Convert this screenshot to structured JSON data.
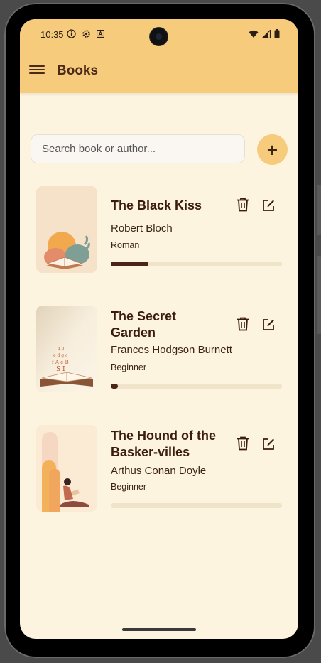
{
  "status": {
    "time": "10:35"
  },
  "appbar": {
    "title": "Books"
  },
  "search": {
    "placeholder": "Search book or author..."
  },
  "add": {
    "label": "+"
  },
  "books": [
    {
      "title": "The Black Kiss",
      "author": "Robert Bloch",
      "genre": "Roman",
      "progress": 0.22
    },
    {
      "title": "The Secret Garden",
      "author": "Frances Hodgson Burnett",
      "genre": "Beginner",
      "progress": 0.04
    },
    {
      "title": "The Hound of the Basker-villes",
      "author": "Arthus Conan Doyle",
      "genre": "Beginner",
      "progress": 0.0
    }
  ],
  "colors": {
    "appbar": "#F7CB7C",
    "background": "#FDF4DF",
    "accent": "#4a2416",
    "title": "#3b1d10"
  },
  "icons": [
    "menu-icon",
    "info-icon",
    "settings-icon",
    "font-icon",
    "wifi-icon",
    "signal-icon",
    "battery-icon",
    "plus-icon",
    "trash-icon",
    "edit-icon"
  ]
}
